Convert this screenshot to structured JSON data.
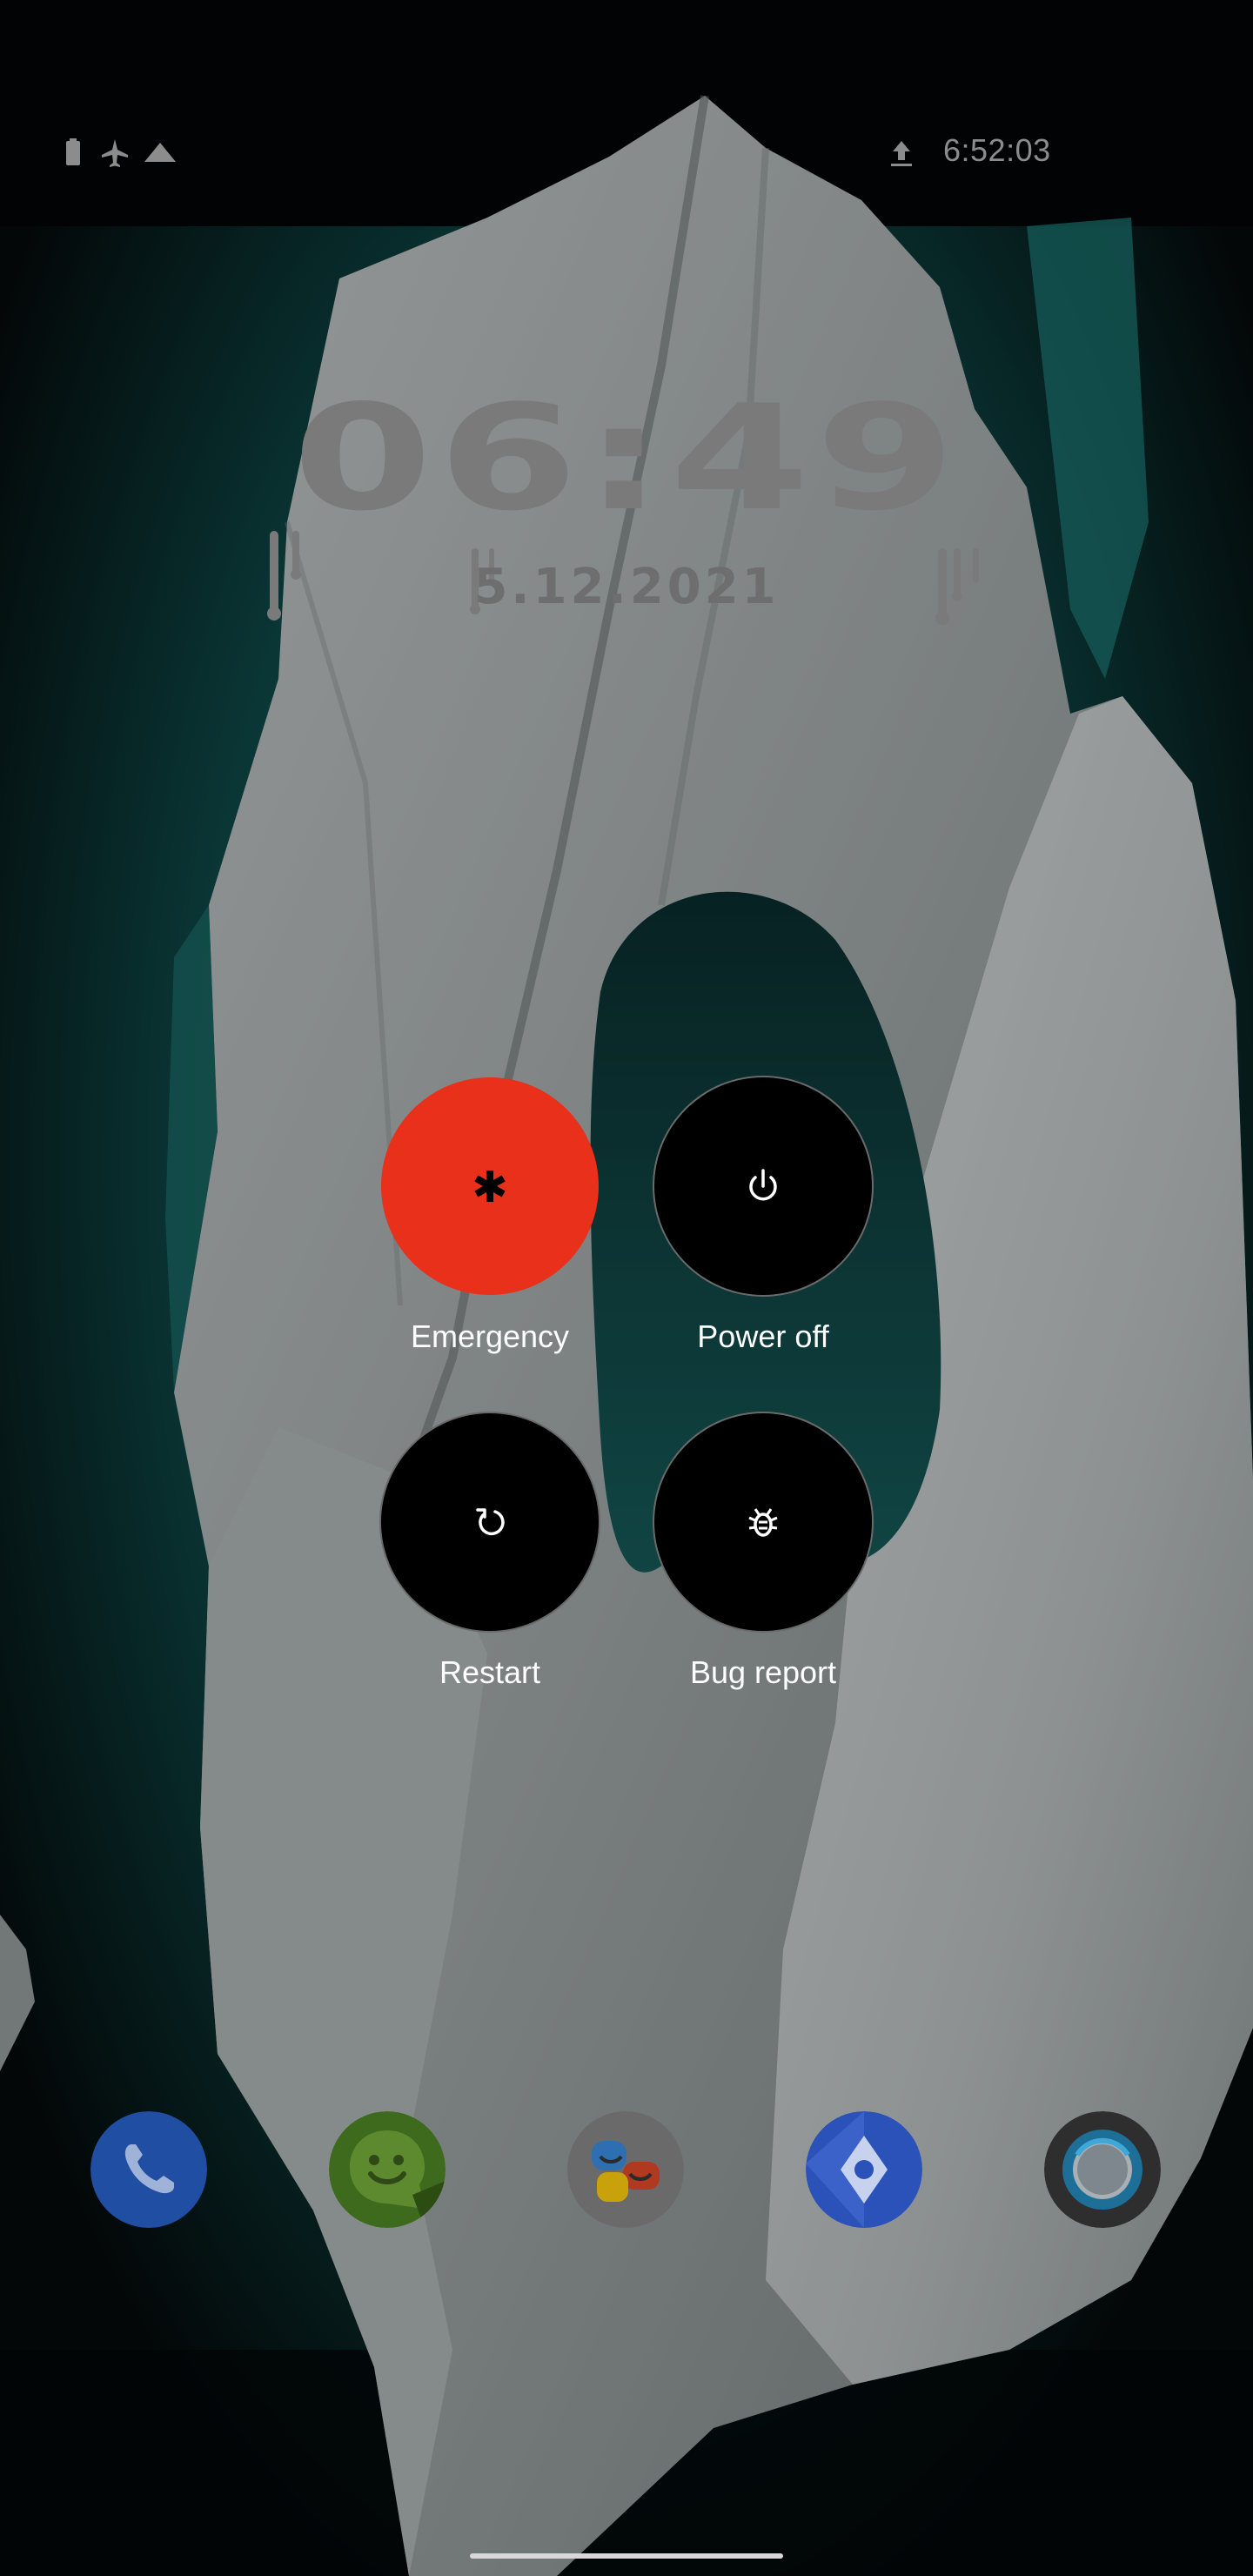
{
  "status_bar": {
    "time": "6:52:03",
    "icons": [
      "battery-icon",
      "airplane-mode-icon",
      "signal-icon",
      "upload-icon"
    ]
  },
  "lock_clock": {
    "time": "06:49",
    "date": "5.12.2021"
  },
  "power_menu": {
    "items": [
      {
        "label": "Emergency",
        "icon": "emergency-asterisk-icon",
        "color": "#e8301a"
      },
      {
        "label": "Power off",
        "icon": "power-icon",
        "color": "#000000"
      },
      {
        "label": "Restart",
        "icon": "restart-icon",
        "color": "#000000"
      },
      {
        "label": "Bug report",
        "icon": "bug-icon",
        "color": "#000000"
      }
    ]
  },
  "dock": {
    "apps": [
      "phone-app-icon",
      "messenger-app-icon",
      "chat-app-icon",
      "maps-app-icon",
      "camera-app-icon"
    ]
  },
  "colors": {
    "emergency": "#e8301a",
    "status_text": "#8c8c8c",
    "clock_text": "#7a7a7a"
  }
}
